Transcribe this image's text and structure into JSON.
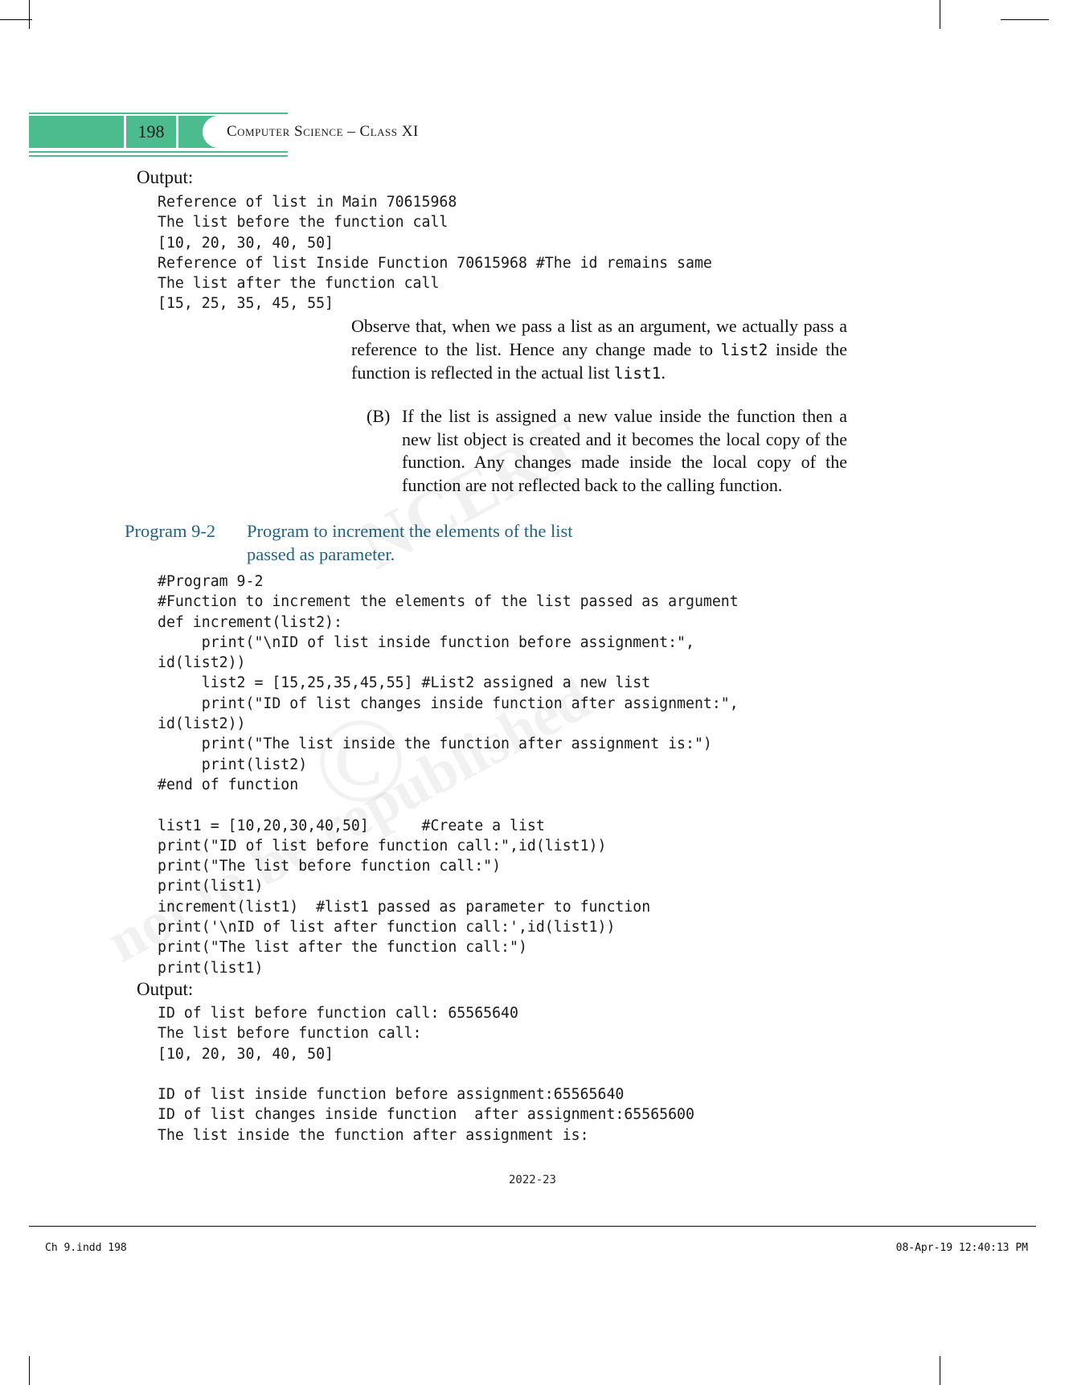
{
  "header": {
    "page_number": "198",
    "book_title": "Computer Science – Class XI",
    "accent_color": "#4cbc8e"
  },
  "watermark": {
    "line1": "NCERT",
    "line2": "not to be republished",
    "copyright_glyph": "©"
  },
  "top_output": {
    "label": "Output:",
    "lines": "Reference of list in Main 70615968\nThe list before the function call\n[10, 20, 30, 40, 50]\nReference of list Inside Function 70615968 #The id remains same\nThe list after the function call\n[15, 25, 35, 45, 55]"
  },
  "paragraphs": {
    "observe_part1": "Observe that, when we pass a list as an argument, we actually pass a reference to the list. Hence any change made to ",
    "observe_code1": "list2",
    "observe_part2": " inside the function is reflected in the actual list ",
    "observe_code2": "list1",
    "observe_part3": ".",
    "item_b_marker": "(B)",
    "item_b_text": "If the list is assigned a new value inside the function then a new list object is created and it becomes the local copy of the function. Any changes made inside the local copy of the function are not reflected back to the calling function."
  },
  "program_heading": {
    "label": "Program 9-2",
    "title": "Program to increment the elements of the list passed as parameter.",
    "color": "#1f6384"
  },
  "program_code": {
    "lines": "#Program 9-2\n#Function to increment the elements of the list passed as argument\ndef increment(list2):\n     print(\"\\nID of list inside function before assignment:\",\nid(list2))\n     list2 = [15,25,35,45,55] #List2 assigned a new list\n     print(\"ID of list changes inside function after assignment:\",\nid(list2))\n     print(\"The list inside the function after assignment is:\")\n     print(list2)\n#end of function\n\nlist1 = [10,20,30,40,50]      #Create a list\nprint(\"ID of list before function call:\",id(list1))\nprint(\"The list before function call:\")\nprint(list1)\nincrement(list1)  #list1 passed as parameter to function\nprint('\\nID of list after function call:',id(list1))\nprint(\"The list after the function call:\")\nprint(list1)"
  },
  "bottom_output": {
    "label": "Output:",
    "lines": "ID of list before function call: 65565640\nThe list before function call:\n[10, 20, 30, 40, 50]\n\nID of list inside function before assignment:65565640\nID of list changes inside function  after assignment:65565600\nThe list inside the function after assignment is:"
  },
  "footer": {
    "year": "2022-23",
    "file_label": "Ch 9.indd   198",
    "timestamp": "08-Apr-19   12:40:13 PM"
  }
}
